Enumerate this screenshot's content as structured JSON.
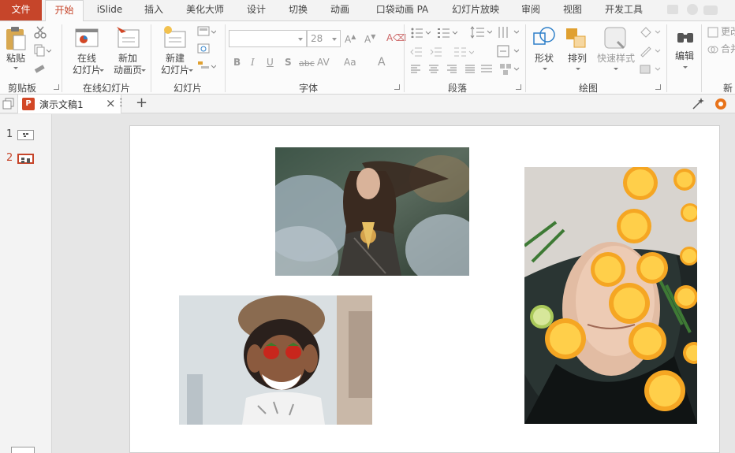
{
  "tabs": [
    "文件",
    "开始",
    "iSlide",
    "插入",
    "美化大师",
    "设计",
    "切换",
    "动画",
    "口袋动画 PA",
    "幻灯片放映",
    "审阅",
    "视图",
    "开发工具"
  ],
  "ribbon": {
    "clipboard": {
      "paste": "粘贴",
      "label": "剪贴板"
    },
    "online": {
      "online_slide": "在线\n幻灯片",
      "new_anim_page": "新加\n动画页",
      "label": "在线幻灯片"
    },
    "slides": {
      "new_slide": "新建\n幻灯片",
      "label": "幻灯片"
    },
    "font": {
      "font_size": "28",
      "label": "字体"
    },
    "paragraph": {
      "label": "段落"
    },
    "drawing": {
      "shape": "形状",
      "arrange": "排列",
      "quick_style": "快速样式",
      "label": "绘图"
    },
    "editing": {
      "edit": "编辑"
    },
    "partial": {
      "update": "更改",
      "merge": "合并",
      "new": "新"
    }
  },
  "document": {
    "title": "演示文稿1",
    "close": "×",
    "more": "⋮",
    "add": "+"
  },
  "slides_panel": [
    {
      "number": "1"
    },
    {
      "number": "2"
    }
  ],
  "colors": {
    "accent": "#c6452a",
    "ribbon_bg": "#fbfbfb",
    "tab_bg": "#f3f3f3"
  },
  "slide_photos": [
    "woman-wind-foliage-photo",
    "woman-strawberries-hat-photo",
    "woman-oranges-bath-photo"
  ]
}
